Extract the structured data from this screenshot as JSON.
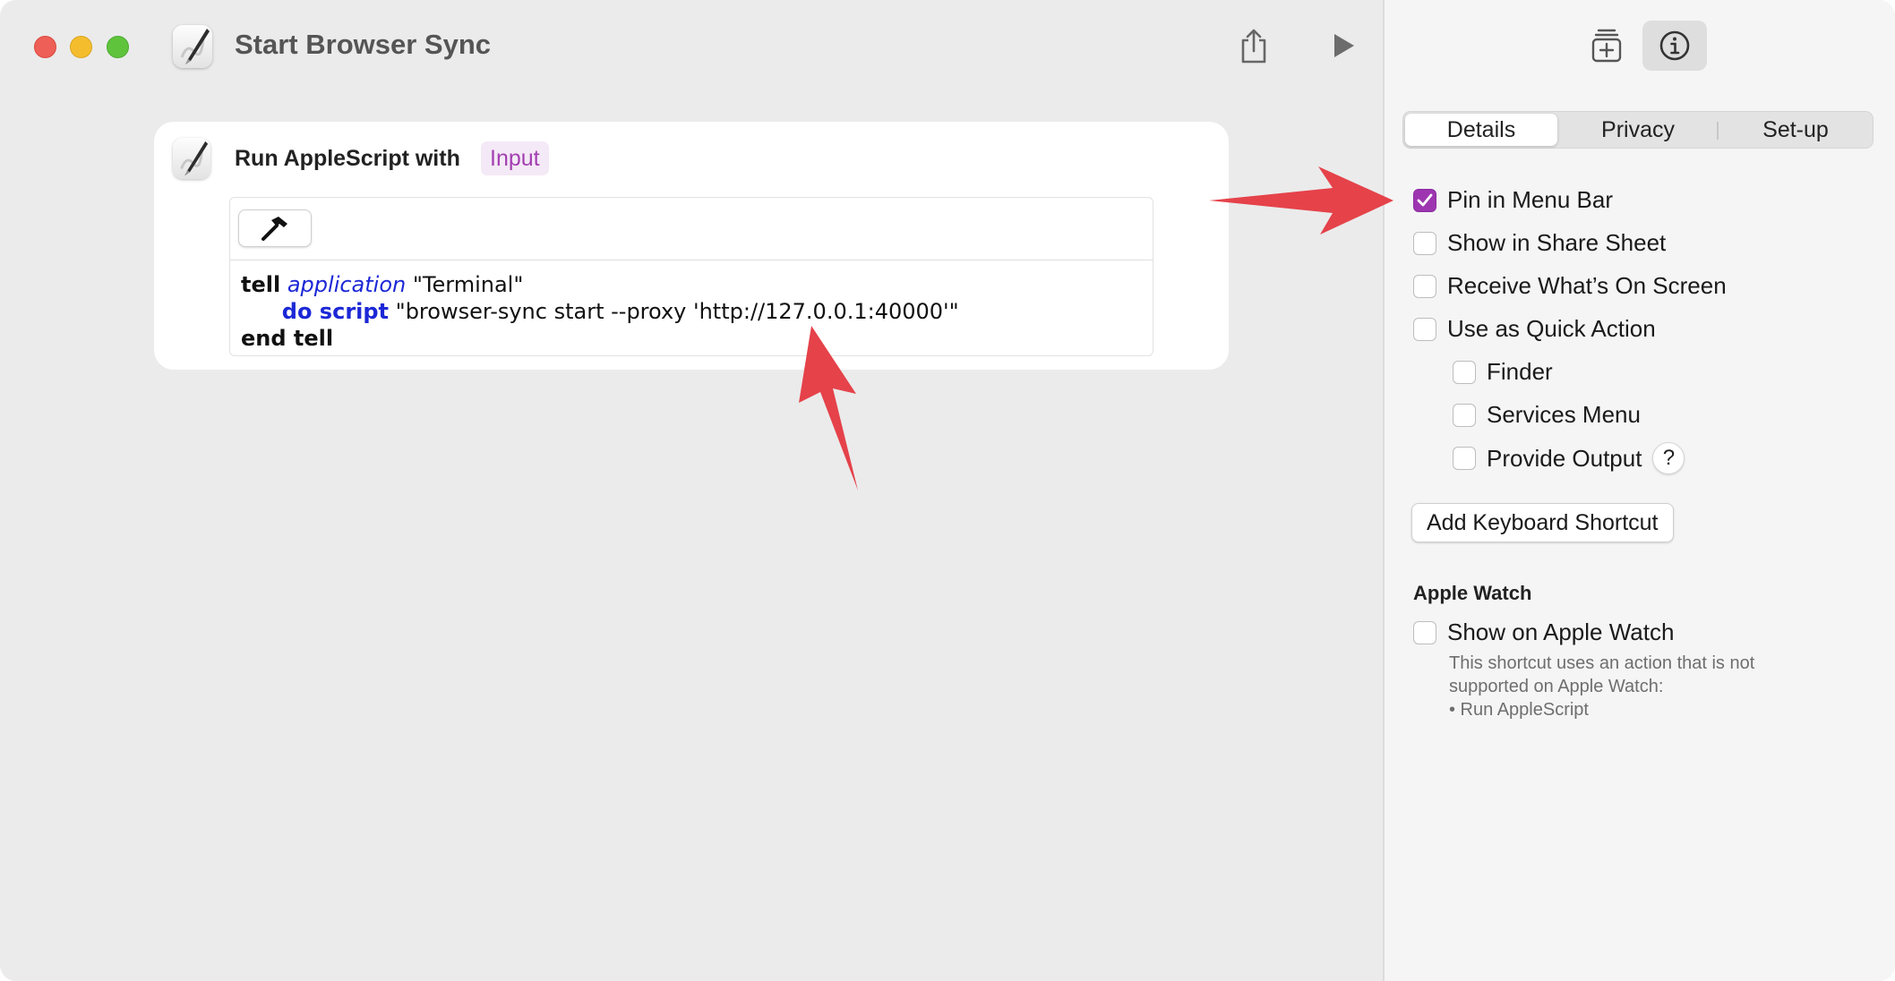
{
  "window": {
    "title": "Start Browser Sync"
  },
  "action": {
    "title": "Run AppleScript with",
    "input_token": "Input",
    "code": {
      "line1": {
        "kw": "tell",
        "app": "application",
        "rest": " \"Terminal\""
      },
      "line2": {
        "indent": "      ",
        "cmd": "do script",
        "rest": " \"browser-sync start --proxy 'http://127.0.0.1:40000'\""
      },
      "line3": {
        "kw": "end tell"
      }
    }
  },
  "tabs": [
    {
      "label": "Details",
      "active": true
    },
    {
      "label": "Privacy",
      "active": false
    },
    {
      "label": "Set-up",
      "active": false
    }
  ],
  "options": {
    "pin_menu_bar": {
      "label": "Pin in Menu Bar",
      "checked": true
    },
    "share_sheet": {
      "label": "Show in Share Sheet",
      "checked": false
    },
    "receive_on_screen": {
      "label": "Receive What’s On Screen",
      "checked": false
    },
    "quick_action": {
      "label": "Use as Quick Action",
      "checked": false
    },
    "finder": {
      "label": "Finder",
      "checked": false
    },
    "services_menu": {
      "label": "Services Menu",
      "checked": false
    },
    "provide_output": {
      "label": "Provide Output",
      "checked": false
    }
  },
  "help_glyph": "?",
  "keyboard_shortcut_button": "Add Keyboard Shortcut",
  "apple_watch": {
    "heading": "Apple Watch",
    "show_label": "Show on Apple Watch",
    "note_line1": "This shortcut uses an action that is not",
    "note_line2": "supported on Apple Watch:",
    "note_line3": "• Run AppleScript"
  },
  "colors": {
    "accent": "#9d35b0",
    "annotation_arrow": "#e5424a",
    "keyword_blue": "#1c28d6"
  },
  "icons": [
    "script-editor-icon",
    "share-icon",
    "play-icon",
    "add-to-library-icon",
    "info-icon",
    "hammer-icon",
    "checkmark-icon"
  ]
}
